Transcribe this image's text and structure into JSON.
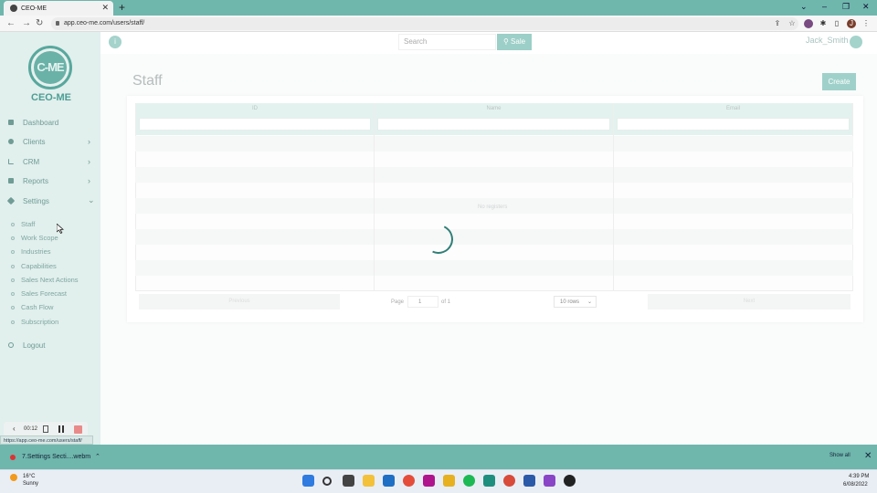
{
  "browser": {
    "tab_title": "CEO-ME",
    "tab_close": "✕",
    "new_tab": "+",
    "url": "app.ceo-me.com/users/staff/",
    "window_controls": [
      "⌄",
      "–",
      "❐",
      "✕"
    ],
    "nav": {
      "back": "←",
      "forward": "→",
      "reload": "↻"
    },
    "profile_initial": "J"
  },
  "sidebar": {
    "logo_text": "C-ME",
    "brand": "CEO-ME",
    "menu": [
      {
        "label": "Dashboard",
        "icon": "home-icon",
        "chevron": ""
      },
      {
        "label": "Clients",
        "icon": "users-icon",
        "chevron": "›"
      },
      {
        "label": "CRM",
        "icon": "chart-icon",
        "chevron": "›"
      },
      {
        "label": "Reports",
        "icon": "report-icon",
        "chevron": "›"
      },
      {
        "label": "Settings",
        "icon": "wrench-icon",
        "chevron": "⌄"
      }
    ],
    "settings_items": [
      "Staff",
      "Work Scope",
      "Industries",
      "Capabilities",
      "Sales Next Actions",
      "Sales Forecast",
      "Cash Flow",
      "Subscription"
    ],
    "logout": "Logout"
  },
  "recorder": {
    "time": "00:12"
  },
  "status_url": "https://app.ceo-me.com/users/staff/",
  "header": {
    "info": "i",
    "search_placeholder": "Search",
    "sale_label": "Sale",
    "username": "Jack_Smith"
  },
  "page": {
    "title": "Staff",
    "create_label": "Create"
  },
  "table": {
    "columns": [
      "ID",
      "Name",
      "Email"
    ],
    "empty_text": "No registers",
    "prev_label": "Previous",
    "next_label": "Next",
    "page_label": "Page",
    "page_value": "1",
    "of_label": "of 1",
    "rows_option": "10 rows"
  },
  "download": {
    "file": "7.Settings Secti....webm",
    "show_all": "Show all",
    "close": "✕"
  },
  "taskbar": {
    "temp": "16°C",
    "weather": "Sunny",
    "time": "4:39 PM",
    "date": "6/08/2022"
  },
  "colors": {
    "accent": "#6fb6ad",
    "sidebar": "#e1efed",
    "button": "#9fd1ca"
  }
}
